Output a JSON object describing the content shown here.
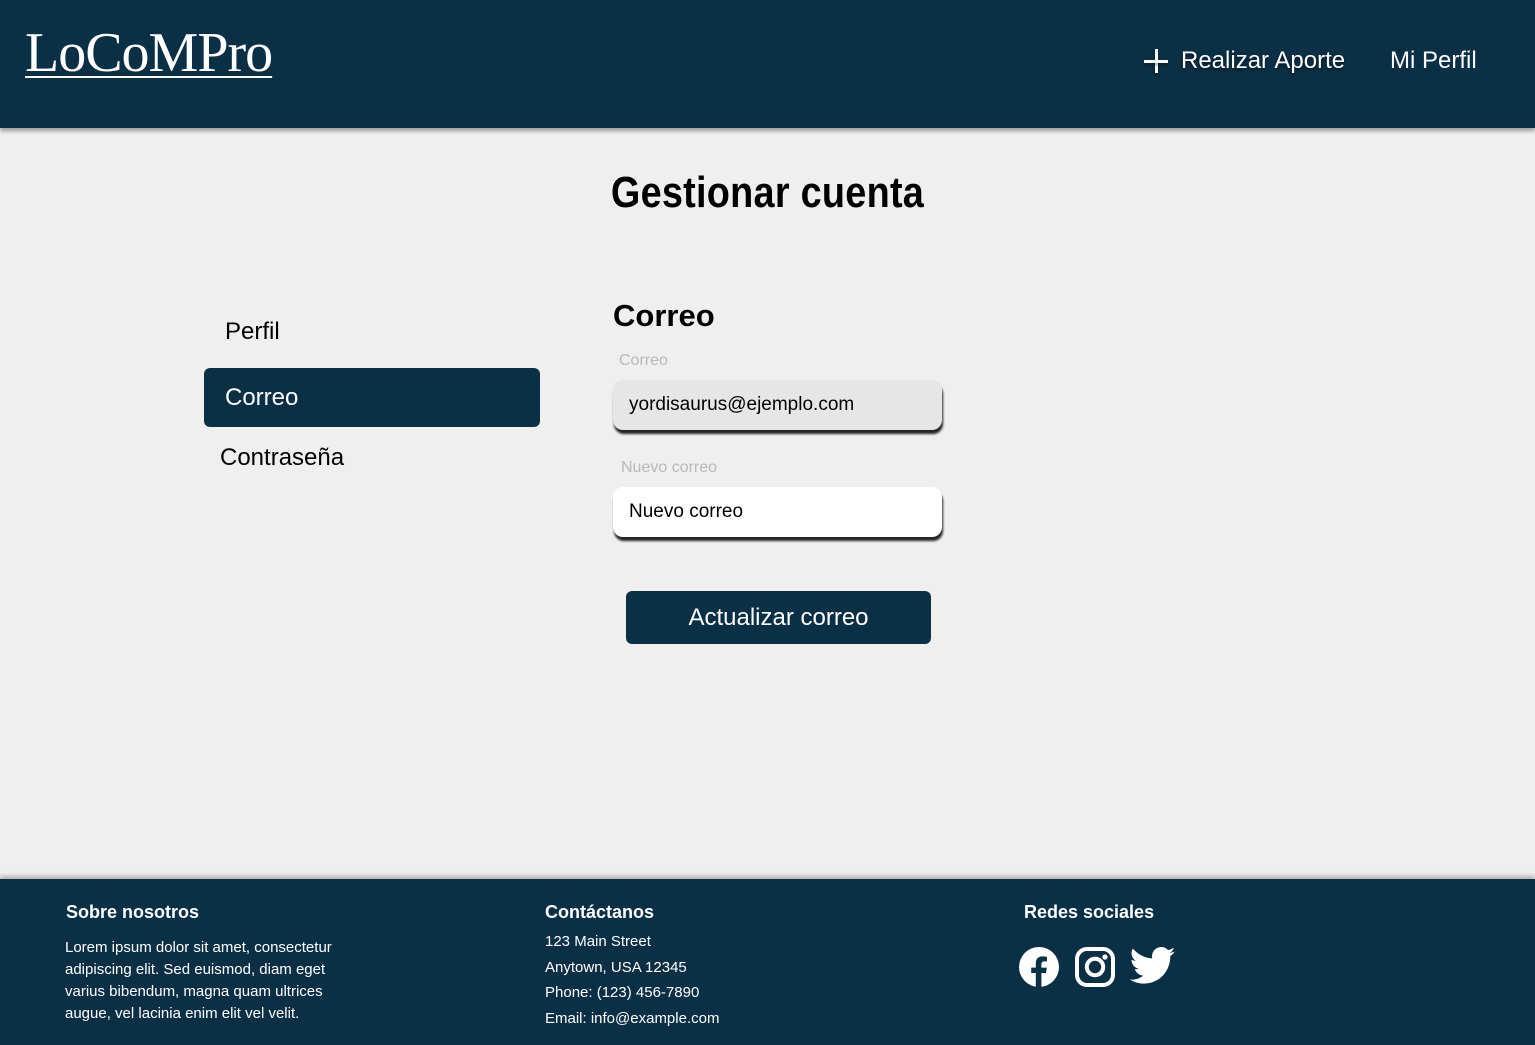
{
  "header": {
    "logo": "LoCoMPro",
    "nav": {
      "aporte_label": "Realizar Aporte",
      "aporte_icon": "plus-icon",
      "perfil_label": "Mi Perfil"
    }
  },
  "page": {
    "title": "Gestionar cuenta"
  },
  "sidebar": {
    "items": [
      {
        "label": "Perfil",
        "active": false
      },
      {
        "label": "Correo",
        "active": true
      },
      {
        "label": "Contraseña",
        "active": false
      }
    ]
  },
  "form": {
    "section_title": "Correo",
    "current_label": "Correo",
    "current_value": "yordisaurus@ejemplo.com",
    "new_label": "Nuevo correo",
    "new_placeholder": "Nuevo correo",
    "submit_label": "Actualizar correo"
  },
  "footer": {
    "about": {
      "title": "Sobre nosotros",
      "text": "Lorem ipsum dolor sit amet, consectetur adipiscing elit. Sed euismod, diam eget varius bibendum, magna quam ultrices augue, vel lacinia enim elit vel velit."
    },
    "contact": {
      "title": "Contáctanos",
      "lines": [
        "123 Main Street",
        "Anytown, USA 12345",
        "Phone: (123) 456-7890",
        "Email: info@example.com"
      ]
    },
    "social": {
      "title": "Redes sociales",
      "icons": [
        "facebook-icon",
        "instagram-icon",
        "twitter-icon"
      ]
    }
  },
  "colors": {
    "primary": "#0b3045",
    "background": "#efefef",
    "label_muted": "#b8b8b8"
  }
}
